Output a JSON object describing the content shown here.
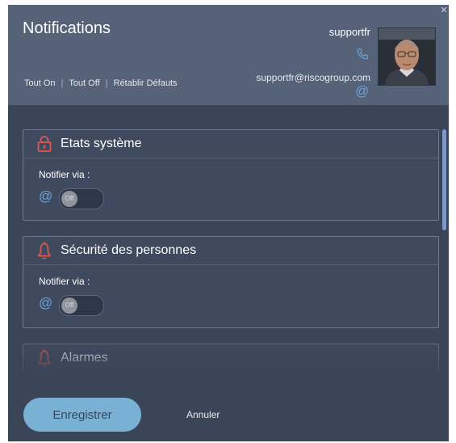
{
  "dialog": {
    "title": "Notifications",
    "close_glyph": "×",
    "quick_actions": {
      "all_on": "Tout On",
      "all_off": "Tout Off",
      "reset": "Rétablir Défauts",
      "separator": "|"
    },
    "user": {
      "name": "supportfr",
      "email": "supportfr@riscogroup.com",
      "at_symbol": "@"
    }
  },
  "cards": [
    {
      "title": "Etats système",
      "icon": "padlock-icon",
      "notify_label": "Notifier via :",
      "channel_symbol": "@",
      "toggle_state": "Off"
    },
    {
      "title": "Sécurité des personnes",
      "icon": "bell-icon",
      "notify_label": "Notifier via :",
      "channel_symbol": "@",
      "toggle_state": "Off"
    },
    {
      "title": "Alarmes",
      "icon": "bell-icon"
    }
  ],
  "footer": {
    "save_label": "Enregistrer",
    "cancel_label": "Annuler"
  },
  "colors": {
    "accent": "#79b1d5",
    "icon_red": "#e0584f",
    "link_blue": "#6fa3d6",
    "panel": "#3b4558",
    "header": "#566278"
  }
}
